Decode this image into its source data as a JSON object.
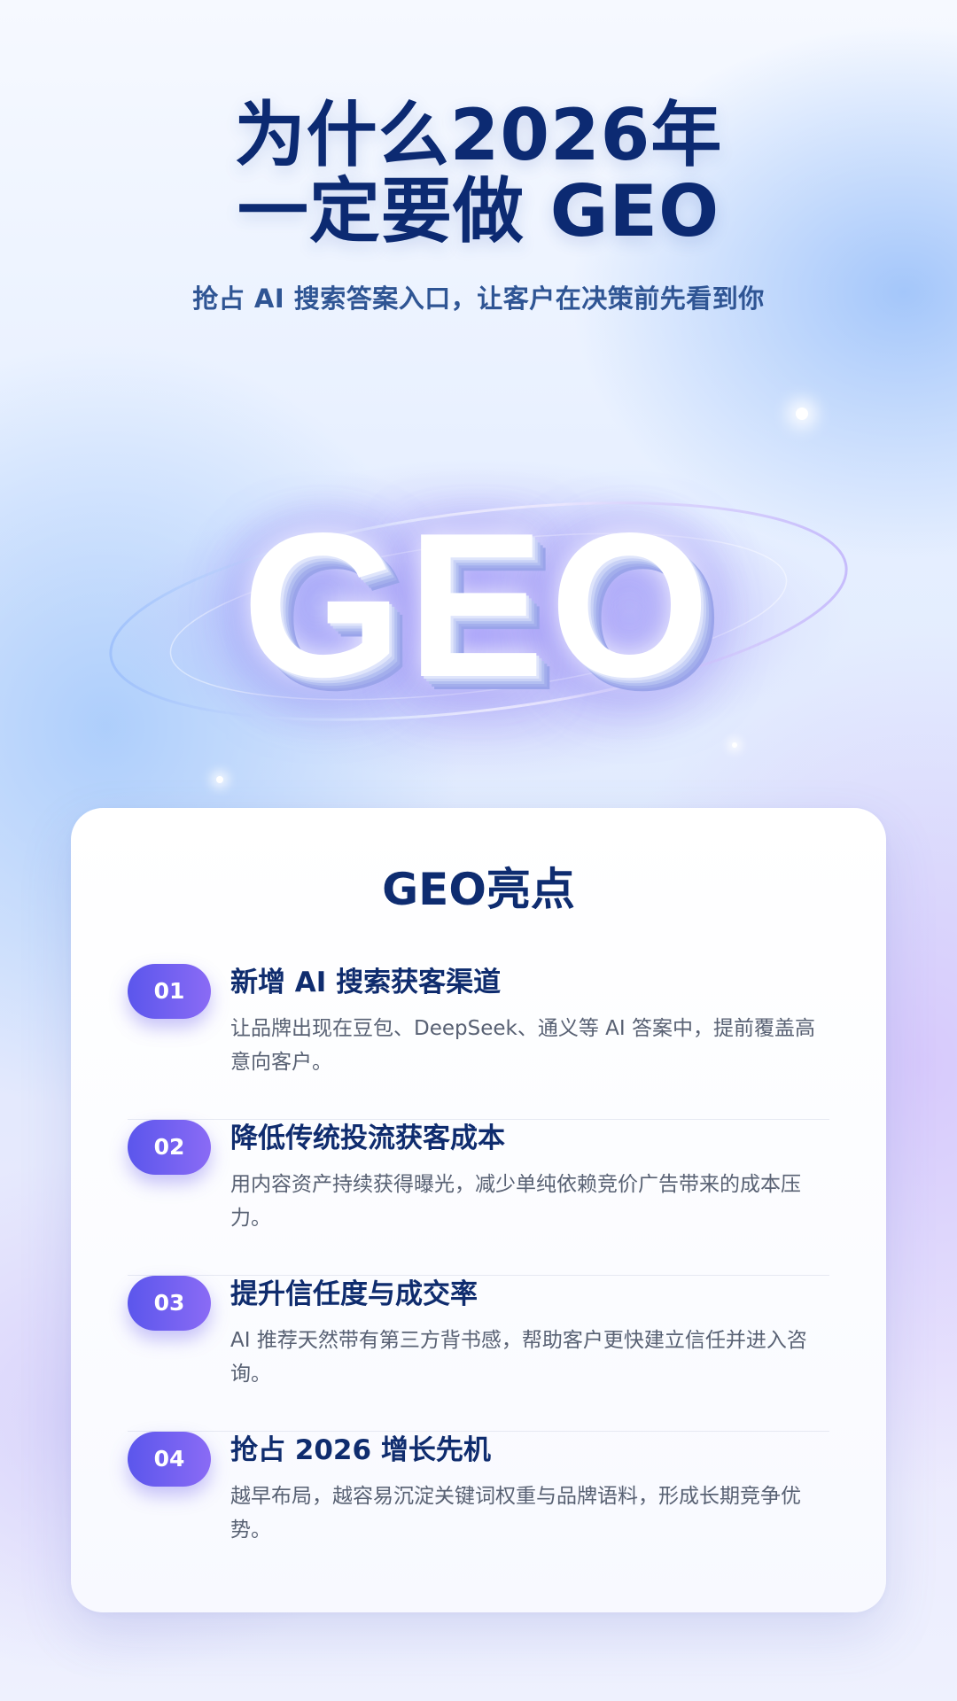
{
  "header": {
    "title_line1": "为什么2026年",
    "title_line2": "一定要做 GEO",
    "subtitle": "抢占 AI 搜索答案入口，让客户在决策前先看到你"
  },
  "hero": {
    "logo_text": "GEO"
  },
  "highlights": {
    "title": "GEO亮点",
    "items": [
      {
        "number": "01",
        "title": "新增 AI 搜索获客渠道",
        "description": "让品牌出现在豆包、DeepSeek、通义等 AI 答案中，提前覆盖高意向客户。"
      },
      {
        "number": "02",
        "title": "降低传统投流获客成本",
        "description": "用内容资产持续获得曝光，减少单纯依赖竞价广告带来的成本压力。"
      },
      {
        "number": "03",
        "title": "提升信任度与成交率",
        "description": "AI 推荐天然带有第三方背书感，帮助客户更快建立信任并进入咨询。"
      },
      {
        "number": "04",
        "title": "抢占 2026 增长先机",
        "description": "越早布局，越容易沉淀关键词权重与品牌语料，形成长期竞争优势。"
      }
    ]
  },
  "colors": {
    "title_navy": "#0c2a72",
    "subtitle_blue": "#2f5594",
    "badge_gradient_start": "#5b56ec",
    "badge_gradient_end": "#8a6bf5",
    "description_gray": "#586173"
  }
}
